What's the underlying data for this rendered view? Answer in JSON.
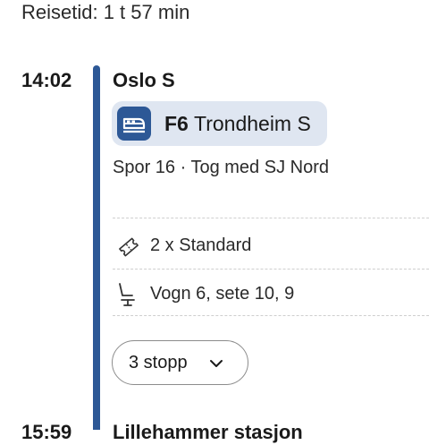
{
  "header": {
    "travel_time": "Reisetid: 1 t 57 min"
  },
  "departure": {
    "time": "14:02",
    "station": "Oslo S",
    "line": {
      "code": "F6",
      "destination": "Trondheim S",
      "icon": "train-icon"
    },
    "track_info": "Spor 16 · Tog med SJ Nord",
    "tickets": {
      "icon": "ticket-icon",
      "text": "2 x Standard"
    },
    "seats": {
      "icon": "seat-icon",
      "text": "Vogn 6, sete 10, 9"
    },
    "stops_button": {
      "label": "3 stopp",
      "icon": "chevron-down-icon"
    }
  },
  "next_stop": {
    "time": "15:59",
    "station": "Lillehammer stasjon"
  },
  "colors": {
    "timeline": "#2d5896",
    "line_chip_bg": "#dfe6f1",
    "text": "#1a1a1a"
  }
}
